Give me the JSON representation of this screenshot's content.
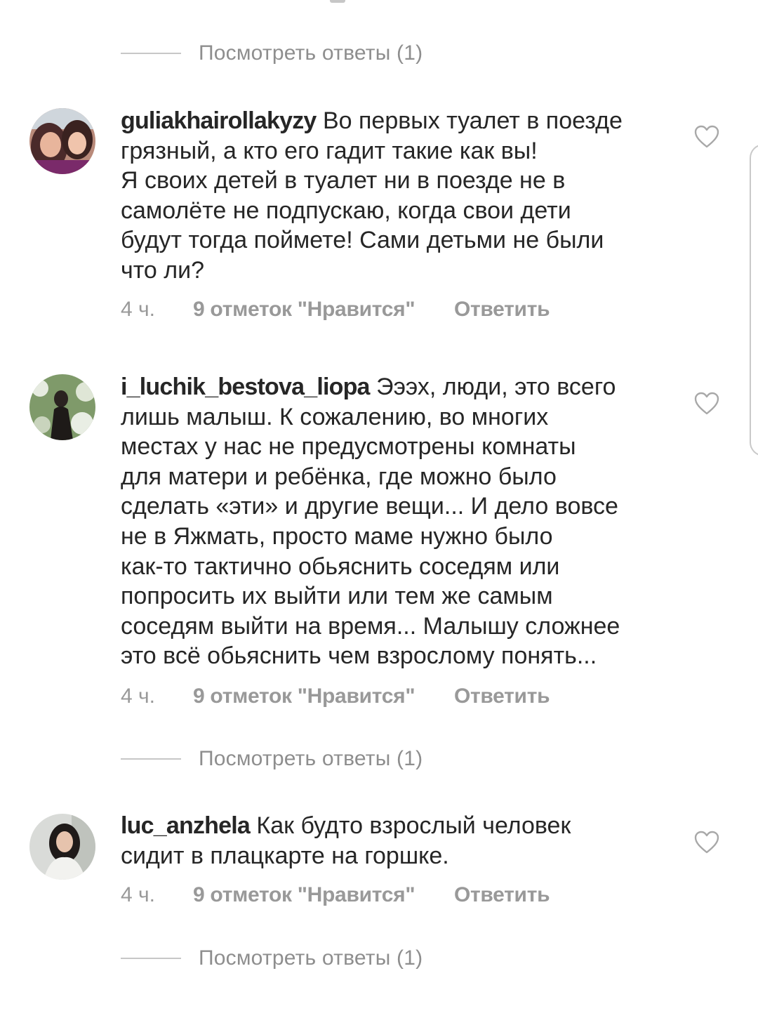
{
  "view_replies_label": "Посмотреть ответы (1)",
  "comments": [
    {
      "username": "guliakhairollakyzy",
      "lines": [
        "Во первых туалет в поезде",
        "грязный, а кто его гадит такие как вы!",
        "Я своих детей в туалет ни в поезде не в",
        "самолёте не подпускаю, когда свои дети",
        "будут тогда поймете! Сами детьми не были",
        "что ли?"
      ],
      "time": "4 ч.",
      "likes": "9 отметок \"Нравится\"",
      "reply": "Ответить",
      "avatar_icon": "avatar-photo-woman-and-child"
    },
    {
      "username": "i_luchik_bestova_liopa",
      "lines": [
        "Эээх, люди, это всего",
        "лишь малыш. К сожалению, во многих",
        "местах у нас не предусмотрены комнаты",
        "для матери и ребёнка, где можно было",
        "сделать «эти» и другие вещи... И дело вовсе",
        "не в Яжмать, просто маме нужно было",
        "как-то тактично обьяснить соседям или",
        "попросить их выйти или тем же самым",
        "соседям выйти на время... Малышу сложнее",
        "это всё обьяснить чем взрослому понять..."
      ],
      "time": "4 ч.",
      "likes": "9 отметок \"Нравится\"",
      "reply": "Ответить",
      "avatar_icon": "avatar-photo-woman-blossoms"
    },
    {
      "username": "luc_anzhela",
      "lines": [
        "Как будто взрослый человек",
        "сидит в плацкарте на горшке."
      ],
      "time": "4 ч.",
      "likes": "9 отметок \"Нравится\"",
      "reply": "Ответить",
      "avatar_icon": "avatar-photo-woman-portrait"
    }
  ],
  "icons": {
    "like": "heart-outline-icon"
  },
  "colors": {
    "text": "#262626",
    "secondary": "#8e8e8e",
    "divider": "#c7c7c7"
  }
}
